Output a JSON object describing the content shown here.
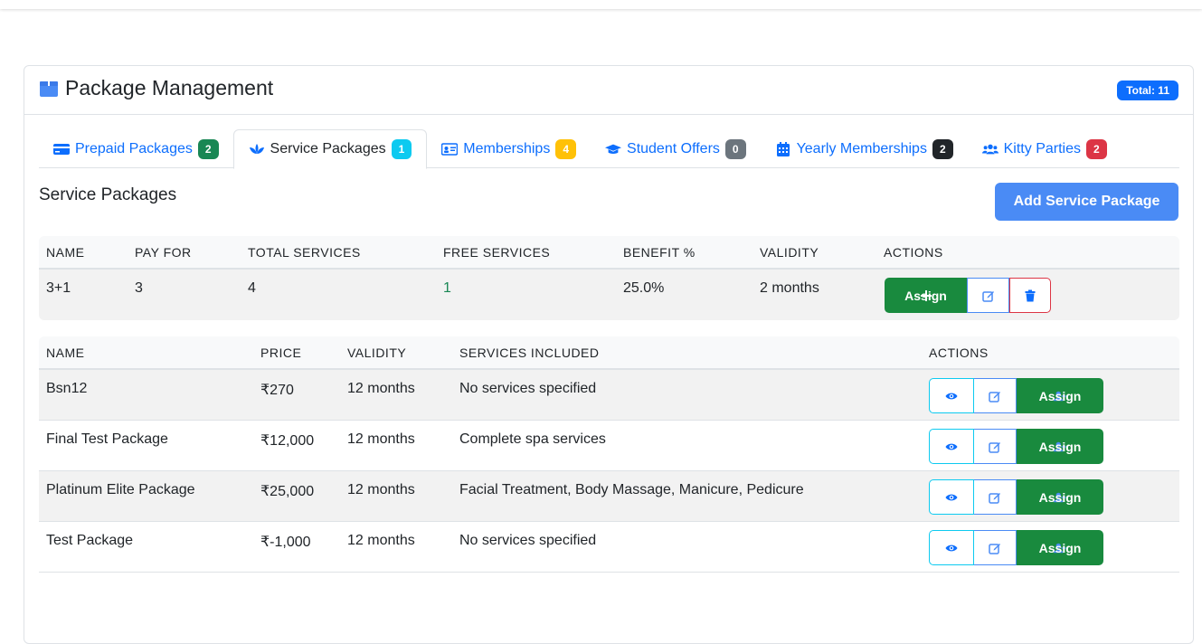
{
  "header": {
    "title": "Package Management",
    "total_badge": "Total: 11"
  },
  "tabs": [
    {
      "label": "Prepaid Packages",
      "count": "2",
      "icon": "credit-card-icon"
    },
    {
      "label": "Service Packages",
      "count": "1",
      "icon": "spa-lotus-icon"
    },
    {
      "label": "Memberships",
      "count": "4",
      "icon": "id-card-icon"
    },
    {
      "label": "Student Offers",
      "count": "0",
      "icon": "graduation-cap-icon"
    },
    {
      "label": "Yearly Memberships",
      "count": "2",
      "icon": "calendar-icon"
    },
    {
      "label": "Kitty Parties",
      "count": "2",
      "icon": "users-icon"
    }
  ],
  "section": {
    "title": "Service Packages",
    "add_button": "Add Service Package"
  },
  "table1": {
    "headers": [
      "NAME",
      "PAY FOR",
      "TOTAL SERVICES",
      "FREE SERVICES",
      "BENEFIT %",
      "VALIDITY",
      "ACTIONS"
    ],
    "rows": [
      {
        "name": "3+1",
        "pay_for": "3",
        "total": "4",
        "free": "1",
        "benefit": "25.0%",
        "validity": "2 months",
        "assign": "Assign"
      }
    ]
  },
  "table2": {
    "headers": [
      "NAME",
      "PRICE",
      "VALIDITY",
      "SERVICES INCLUDED",
      "ACTIONS"
    ],
    "rows": [
      {
        "name": "Bsn12",
        "price": "₹270",
        "validity": "12 months",
        "services": "No services specified",
        "assign": "Assign"
      },
      {
        "name": "Final Test Package",
        "price": "₹12,000",
        "validity": "12 months",
        "services": "Complete spa services",
        "assign": "Assign"
      },
      {
        "name": "Platinum Elite Package",
        "price": "₹25,000",
        "validity": "12 months",
        "services": "Facial Treatment, Body Massage, Manicure, Pedicure",
        "assign": "Assign"
      },
      {
        "name": "Test Package",
        "price": "₹-1,000",
        "validity": "12 months",
        "services": "No services specified",
        "assign": "Assign"
      }
    ]
  },
  "colors": {
    "primary": "#0d6efd",
    "success": "#198754",
    "danger": "#dc3545",
    "info": "#0dcaf0",
    "warning": "#ffc107"
  }
}
